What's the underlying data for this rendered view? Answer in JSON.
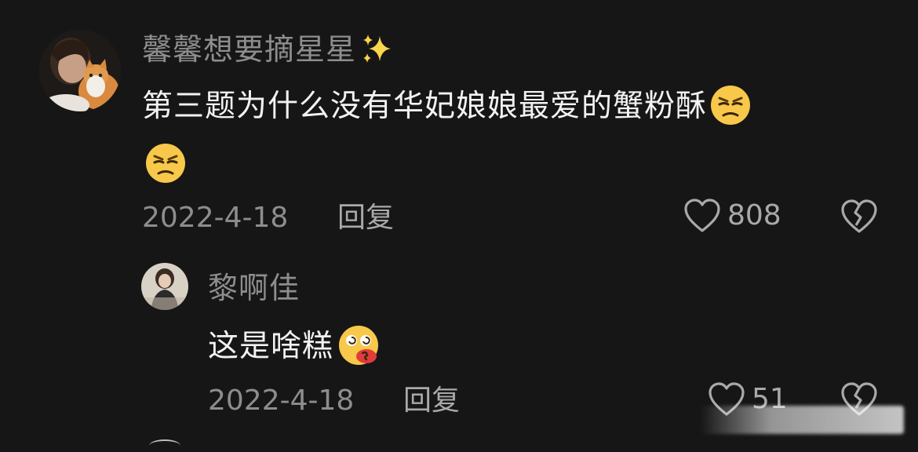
{
  "comment": {
    "username": "馨馨想要摘星星",
    "username_emoji": "sparkles-icon",
    "text": "第三题为什么没有华妃娘娘最爱的蟹粉酥",
    "emojis": [
      "unamused-face-icon",
      "unamused-face-icon"
    ],
    "date": "2022-4-18",
    "reply_label": "回复",
    "like_count": "808"
  },
  "reply": {
    "username": "黎啊佳",
    "text": "这是啥糕",
    "emoji": "dizzy-face-icon",
    "date": "2022-4-18",
    "reply_label": "回复",
    "like_count": "51"
  },
  "colors": {
    "background": "#161616",
    "text_primary": "#f2f2f2",
    "text_secondary": "#8d8d8d",
    "emoji_yellow": "#f7c84a"
  }
}
